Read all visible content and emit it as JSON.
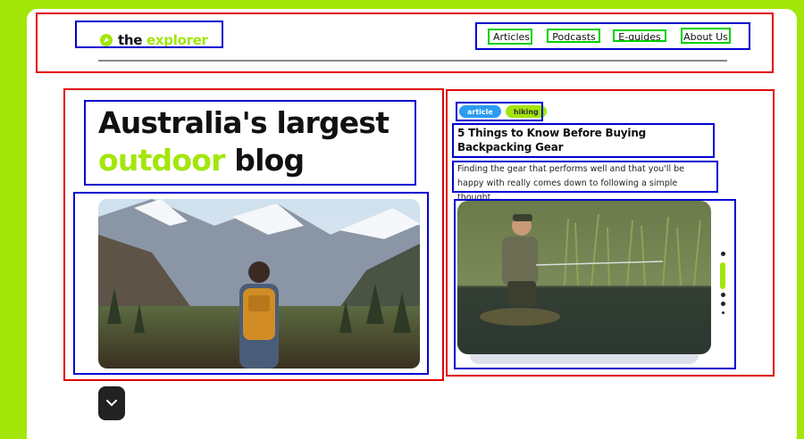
{
  "brand": {
    "name_part1": "the ",
    "name_part2": "explorer",
    "accent_color": "#a3e60a"
  },
  "nav": {
    "items": [
      {
        "label": "Articles"
      },
      {
        "label": "Podcasts"
      },
      {
        "label": "E-guides"
      },
      {
        "label": "About Us"
      }
    ]
  },
  "hero": {
    "title_line1": "Australia's largest",
    "title_green": "outdoor",
    "title_rest": " blog",
    "image_icon": "mountain-hiker-photo"
  },
  "featured_post": {
    "tags": [
      "article",
      "hiking"
    ],
    "title": "5 Things to Know Before Buying Backpacking Gear",
    "excerpt": "Finding the gear that performs well and that you'll be happy with really comes down to following a simple thought...",
    "image_icon": "fishing-man-photo"
  },
  "scroll_button_icon": "chevron-down-icon",
  "annotation_colors": {
    "section": "#e00000",
    "group": "#0000d0",
    "link": "#00d000"
  }
}
